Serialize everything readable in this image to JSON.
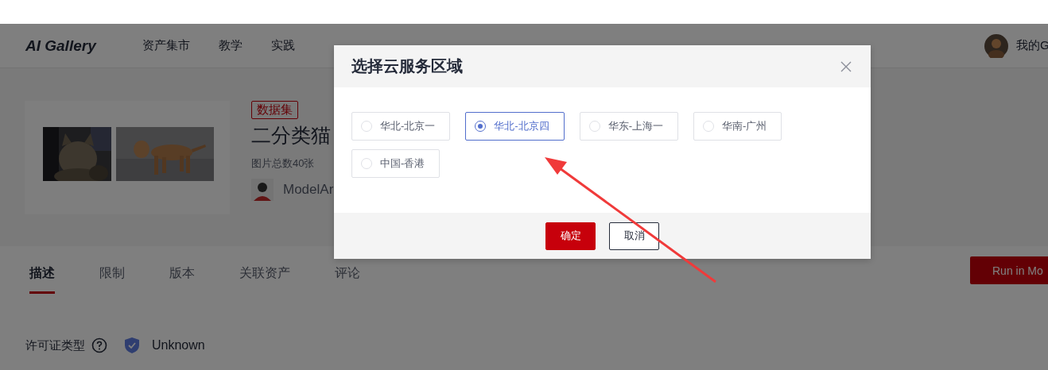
{
  "top_nav": {
    "logo": "AI Gallery",
    "items": [
      {
        "label": "资产集市"
      },
      {
        "label": "教学"
      },
      {
        "label": "实践"
      }
    ],
    "user": "我的G"
  },
  "dataset": {
    "tag": "数据集",
    "title": "二分类猫",
    "image_count": "图片总数40张",
    "author": "ModelAr"
  },
  "tabs": [
    {
      "label": "描述",
      "selected": true
    },
    {
      "label": "限制",
      "selected": false
    },
    {
      "label": "版本",
      "selected": false
    },
    {
      "label": "关联资产",
      "selected": false
    },
    {
      "label": "评论",
      "selected": false
    }
  ],
  "run_button": "Run in Mo",
  "license": {
    "label": "许可证类型",
    "value": "Unknown"
  },
  "dialog": {
    "title": "选择云服务区域",
    "regions": [
      {
        "label": "华北-北京一",
        "selected": false
      },
      {
        "label": "华北-北京四",
        "selected": true
      },
      {
        "label": "华东-上海一",
        "selected": false
      },
      {
        "label": "华南-广州",
        "selected": false
      },
      {
        "label": "中国-香港",
        "selected": false
      }
    ],
    "buttons": [
      {
        "label": "确定",
        "kind": "primary"
      },
      {
        "label": "取消",
        "kind": "secondary"
      }
    ]
  }
}
